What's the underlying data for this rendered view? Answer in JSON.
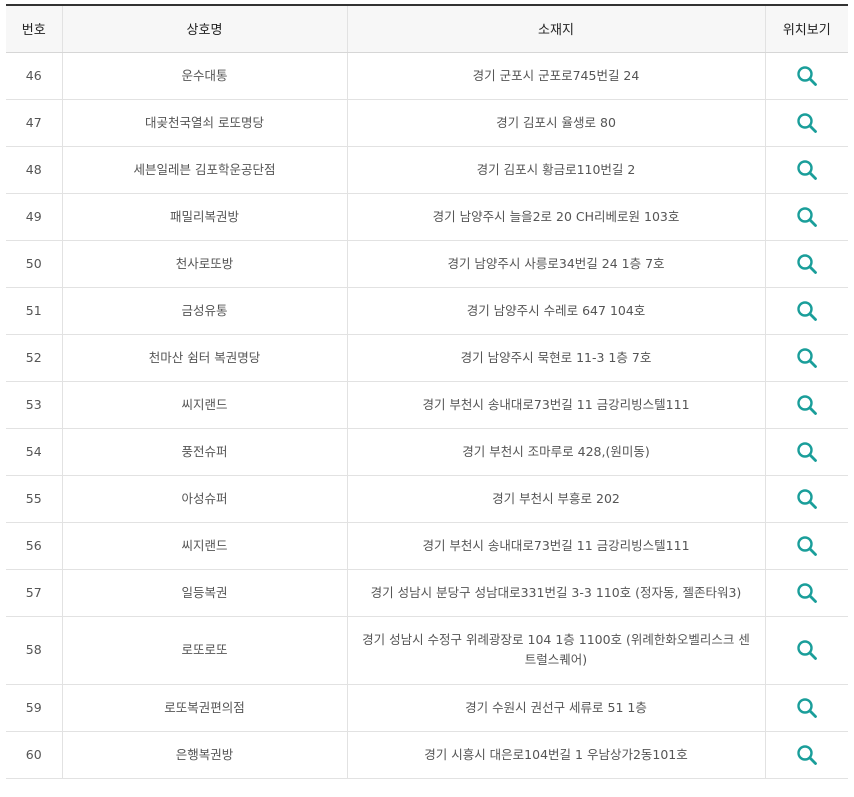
{
  "table": {
    "headers": {
      "number": "번호",
      "name": "상호명",
      "address": "소재지",
      "location": "위치보기"
    },
    "accent_color": "#1a9e9a",
    "location_icon": "search-icon",
    "rows": [
      {
        "number": "46",
        "name": "운수대통",
        "address": "경기 군포시 군포로745번길 24"
      },
      {
        "number": "47",
        "name": "대곶천국열쇠 로또명당",
        "address": "경기 김포시 율생로 80"
      },
      {
        "number": "48",
        "name": "세븐일레븐 김포학운공단점",
        "address": "경기 김포시 황금로110번길 2"
      },
      {
        "number": "49",
        "name": "패밀리복권방",
        "address": "경기 남양주시 늘을2로 20 CH리베로원 103호"
      },
      {
        "number": "50",
        "name": "천사로또방",
        "address": "경기 남양주시 사릉로34번길 24 1층 7호"
      },
      {
        "number": "51",
        "name": "금성유통",
        "address": "경기 남양주시 수레로 647 104호"
      },
      {
        "number": "52",
        "name": "천마산 쉼터 복권명당",
        "address": "경기 남양주시 묵현로 11-3 1층 7호"
      },
      {
        "number": "53",
        "name": "씨지랜드",
        "address": "경기 부천시 송내대로73번길 11 금강리빙스텔111"
      },
      {
        "number": "54",
        "name": "풍전슈퍼",
        "address": "경기 부천시 조마루로 428,(원미동)"
      },
      {
        "number": "55",
        "name": "아성슈퍼",
        "address": "경기 부천시 부흥로 202"
      },
      {
        "number": "56",
        "name": "씨지랜드",
        "address": "경기 부천시 송내대로73번길 11 금강리빙스텔111"
      },
      {
        "number": "57",
        "name": "일등복권",
        "address": "경기 성남시 분당구 성남대로331번길 3-3 110호 (정자동, 젤존타워3)"
      },
      {
        "number": "58",
        "name": "로또로또",
        "address": "경기 성남시 수정구 위례광장로 104 1층 1100호 (위례한화오벨리스크 센트럴스퀘어)"
      },
      {
        "number": "59",
        "name": "로또복권편의점",
        "address": "경기 수원시 권선구 세류로 51 1층"
      },
      {
        "number": "60",
        "name": "은행복권방",
        "address": "경기 시흥시 대은로104번길 1 우남상가2동101호"
      }
    ]
  }
}
